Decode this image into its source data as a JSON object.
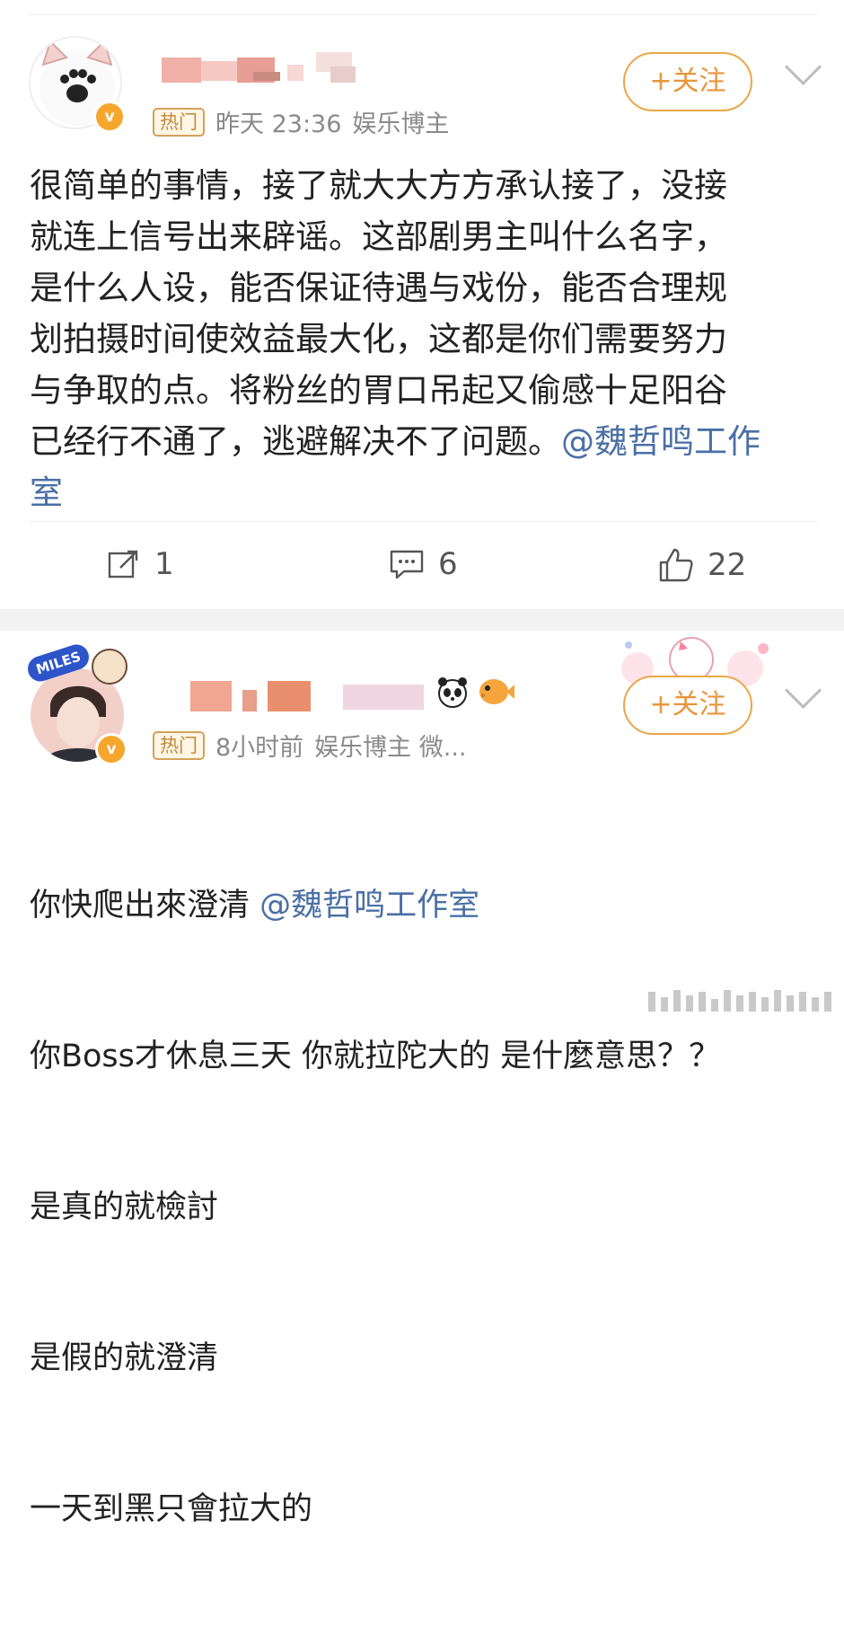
{
  "post1": {
    "hot_badge": "热门",
    "time": "昨天 23:36",
    "category": "娱乐博主",
    "follow_label": "+关注",
    "text_main": "很简单的事情，接了就大大方方承认接了，没接\n就连上信号出来辟谣。这部剧男主叫什么名字，\n是什么人设，能否保证待遇与戏份，能否合理规\n划拍摄时间使效益最大化，这都是你们需要努力\n与争取的点。将粉丝的胃口吊起又偷感十足阳谷\n已经行不通了，逃避解决不了问题。",
    "mention": "@魏哲鸣工作\n室",
    "repost_count": "1",
    "comment_count": "6",
    "like_count": "22",
    "verified_mark": "v"
  },
  "post2": {
    "hot_badge": "热门",
    "time": "8小时前",
    "category": "娱乐博主 微...",
    "follow_label": "+关注",
    "line1_prefix": "你快爬出來澄清 ",
    "line1_mention": "@魏哲鸣工作室",
    "line2": "你Boss才休息三天 你就拉陀大的 是什麼意思？？",
    "line3": "是真的就檢討",
    "line4": "是假的就澄清",
    "line5": "一天到黑只會拉大的",
    "verified_mark": "v",
    "avatar_badge_text": "MILES"
  },
  "colors": {
    "accent": "#e8953a",
    "mention": "#4a6fa5",
    "verified": "#f7a62d"
  }
}
